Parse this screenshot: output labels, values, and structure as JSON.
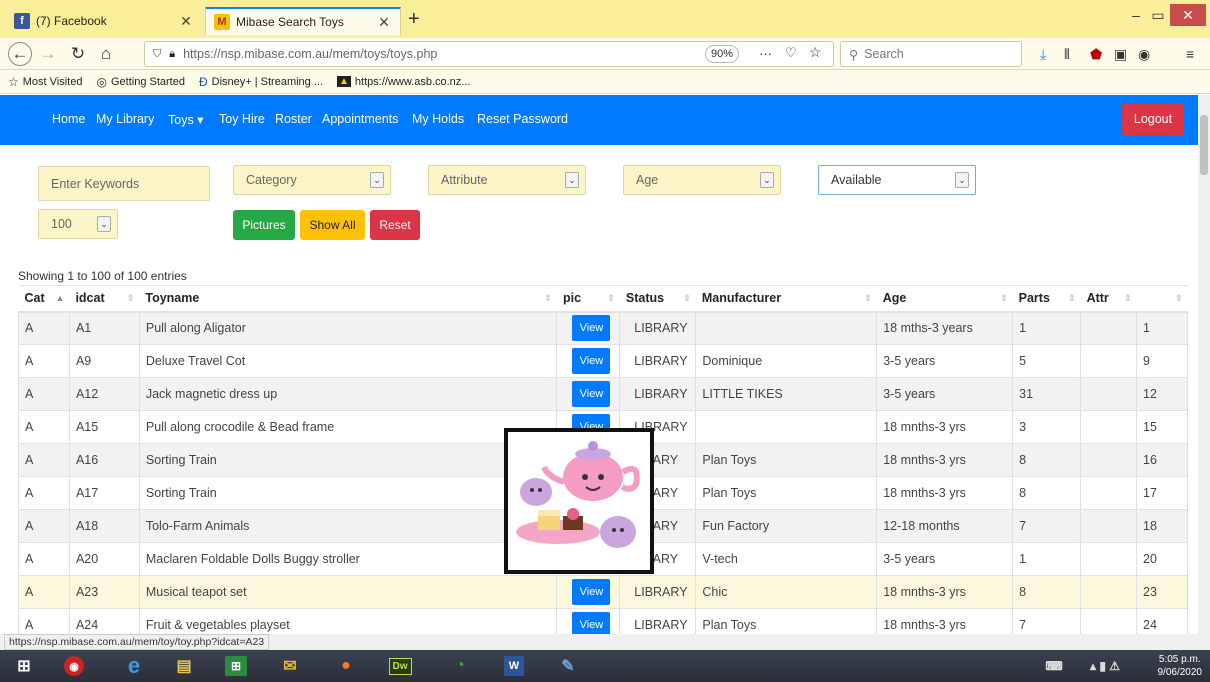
{
  "browser": {
    "tabs": [
      {
        "title": "(7) Facebook",
        "favicon": "facebook-icon"
      },
      {
        "title": "Mibase Search Toys",
        "favicon": "mibase-icon"
      }
    ],
    "url": "https://nsp.mibase.com.au/mem/toys/toys.php",
    "url_domain": "mibase.com.au",
    "zoom": "90%",
    "search_placeholder": "Search",
    "bookmarks": [
      "Most Visited",
      "Getting Started",
      "Disney+ | Streaming ...",
      "https://www.asb.co.nz..."
    ],
    "status_url": "https://nsp.mibase.com.au/mem/toy/toy.php?idcat=A23"
  },
  "nav": {
    "items": [
      "Home",
      "My Library",
      "Toys ▾",
      "Toy Hire",
      "Roster",
      "Appointments",
      "My Holds",
      "Reset Password"
    ],
    "logout": "Logout"
  },
  "filters": {
    "keywords_placeholder": "Enter Keywords",
    "category": "Category",
    "attribute": "Attribute",
    "age": "Age",
    "available": "Available",
    "page_size": "100",
    "pictures": "Pictures",
    "show_all": "Show All",
    "reset": "Reset"
  },
  "colors": {
    "nav_blue": "#007bff",
    "logout_red": "#dc3545",
    "pictures_green": "#28a745",
    "showall_yellow": "#ffc107",
    "reset_red": "#dc3545"
  },
  "table": {
    "showing": "Showing 1 to 100 of 100 entries",
    "headers": [
      "Cat",
      "idcat",
      "Toyname",
      "pic",
      "Status",
      "Manufacturer",
      "Age",
      "Parts",
      "Attr",
      ""
    ],
    "view_label": "View",
    "rows": [
      {
        "cat": "A",
        "idcat": "A1",
        "name": "Pull along Aligator",
        "status": "LIBRARY",
        "manufacturer": "",
        "age": "18 mths-3 years",
        "parts": "1",
        "attr": "",
        "num": "1"
      },
      {
        "cat": "A",
        "idcat": "A9",
        "name": "Deluxe Travel Cot",
        "status": "LIBRARY",
        "manufacturer": "Dominique",
        "age": "3-5 years",
        "parts": "5",
        "attr": "",
        "num": "9"
      },
      {
        "cat": "A",
        "idcat": "A12",
        "name": "Jack magnetic dress up",
        "status": "LIBRARY",
        "manufacturer": "LITTLE TIKES",
        "age": "3-5 years",
        "parts": "31",
        "attr": "",
        "num": "12"
      },
      {
        "cat": "A",
        "idcat": "A15",
        "name": "Pull along crocodile & Bead frame",
        "status": "LIBRARY",
        "manufacturer": "",
        "age": "18 mnths-3 yrs",
        "parts": "3",
        "attr": "",
        "num": "15"
      },
      {
        "cat": "A",
        "idcat": "A16",
        "name": "Sorting Train",
        "status": "RARY",
        "manufacturer": "Plan Toys",
        "age": "18 mnths-3 yrs",
        "parts": "8",
        "attr": "",
        "num": "16"
      },
      {
        "cat": "A",
        "idcat": "A17",
        "name": "Sorting Train",
        "status": "RARY",
        "manufacturer": "Plan Toys",
        "age": "18 mnths-3 yrs",
        "parts": "8",
        "attr": "",
        "num": "17"
      },
      {
        "cat": "A",
        "idcat": "A18",
        "name": "Tolo-Farm Animals",
        "status": "RARY",
        "manufacturer": "Fun Factory",
        "age": "12-18 months",
        "parts": "7",
        "attr": "",
        "num": "18"
      },
      {
        "cat": "A",
        "idcat": "A20",
        "name": "Maclaren Foldable Dolls Buggy stroller",
        "status": "RARY",
        "manufacturer": "V-tech",
        "age": "3-5 years",
        "parts": "1",
        "attr": "",
        "num": "20"
      },
      {
        "cat": "A",
        "idcat": "A23",
        "name": "Musical teapot set",
        "status": "LIBRARY",
        "manufacturer": "Chic",
        "age": "18 mnths-3 yrs",
        "parts": "8",
        "attr": "",
        "num": "23"
      },
      {
        "cat": "A",
        "idcat": "A24",
        "name": "Fruit & vegetables playset",
        "status": "LIBRARY",
        "manufacturer": "Plan Toys",
        "age": "18 mnths-3 yrs",
        "parts": "7",
        "attr": "",
        "num": "24"
      }
    ]
  },
  "taskbar": {
    "time": "5:05 p.m.",
    "date": "9/06/2020"
  }
}
